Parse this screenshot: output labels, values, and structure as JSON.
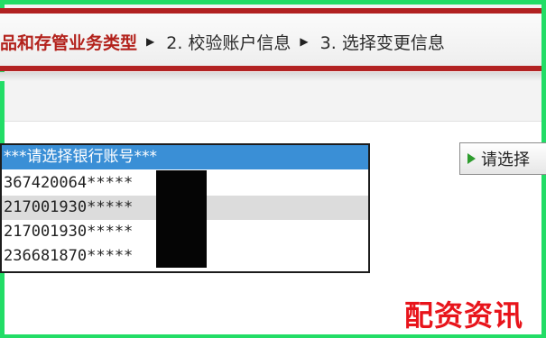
{
  "steps": [
    {
      "label": "品和存管业务类型",
      "active": true
    },
    {
      "label": "2. 校验账户信息",
      "active": false
    },
    {
      "label": "3. 选择变更信息",
      "active": false
    }
  ],
  "account_select": {
    "header": "***请选择银行账号***",
    "options": [
      "367420064*****",
      "217001930*****",
      "217001930*****",
      "236681870*****"
    ],
    "highlighted_index": 1
  },
  "choose_button": {
    "label": "请选择"
  },
  "watermark": {
    "text": "配资资讯"
  },
  "colors": {
    "frame_border": "#22dd66",
    "banner_border": "#b22222",
    "active_step": "#b3221c",
    "select_header": "#3a8fd6",
    "watermark": "#e8141b"
  },
  "icons": {
    "step_separator": "triangle-right-icon",
    "button": "play-icon"
  }
}
